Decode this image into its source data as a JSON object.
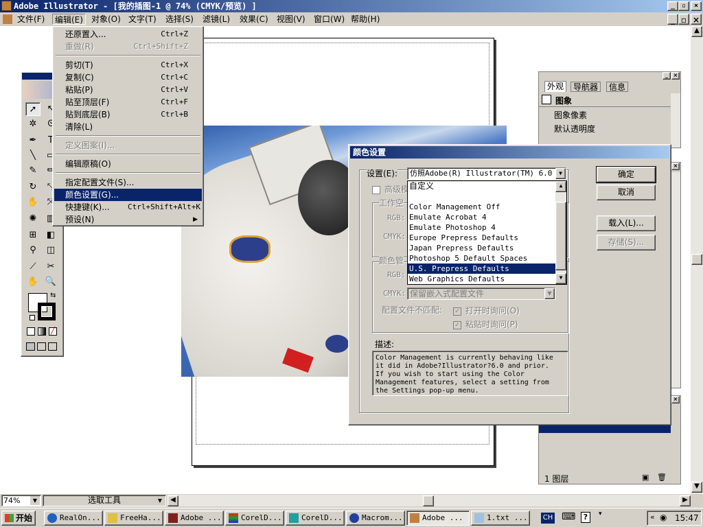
{
  "window": {
    "title": "Adobe Illustrator - [我的插图-1 @ 74% (CMYK/预览) ]"
  },
  "menubar": {
    "items": [
      "文件(F)",
      "编辑(E)",
      "对象(O)",
      "文字(T)",
      "选择(S)",
      "滤镜(L)",
      "效果(C)",
      "视图(V)",
      "窗口(W)",
      "帮助(H)"
    ]
  },
  "edit_menu": {
    "items": [
      {
        "label": "还原置入...",
        "key": "Ctrl+Z"
      },
      {
        "label": "重做(R)",
        "key": "Ctrl+Shift+Z"
      },
      {
        "label": "剪切(T)",
        "key": "Ctrl+X"
      },
      {
        "label": "复制(C)",
        "key": "Ctrl+C"
      },
      {
        "label": "粘贴(P)",
        "key": "Ctrl+V"
      },
      {
        "label": "贴至顶层(F)",
        "key": "Ctrl+F"
      },
      {
        "label": "贴到底层(B)",
        "key": "Ctrl+B"
      },
      {
        "label": "清除(L)",
        "key": ""
      },
      {
        "label": "定义图案(I)...",
        "key": ""
      },
      {
        "label": "编辑原稿(O)",
        "key": ""
      },
      {
        "label": "指定配置文件(S)...",
        "key": ""
      },
      {
        "label": "颜色设置(G)...",
        "key": ""
      },
      {
        "label": "快捷键(K)...",
        "key": "Ctrl+Shift+Alt+K"
      },
      {
        "label": "预设(N)",
        "key": ""
      }
    ]
  },
  "appearance_panel": {
    "tabs": [
      "外观",
      "导航器",
      "信息"
    ],
    "object": "图象",
    "rows": [
      "图象像素",
      "默认透明度"
    ]
  },
  "color_dialog": {
    "title": "颜色设置",
    "settings_label": "设置(E):",
    "settings_value": "仿照Adobe(R) Illustrator(TM) 6.0",
    "advanced_label": "高级模",
    "workspace_label": "工作空",
    "rgb_label": "RGB:",
    "cmyk_label": "CMYK:",
    "policy_label": "颜色管",
    "policy_cmyk_value": "保留嵌入式配置文件",
    "mismatch_label": "配置文件不匹配:",
    "ask_open": "打开时询问(O)",
    "ask_paste": "粘贴时询问(P)",
    "dropdown_options": [
      "自定义",
      "Color Management Off",
      "Emulate Acrobat 4",
      "Emulate Photoshop 4",
      "Europe Prepress Defaults",
      "Japan Prepress Defaults",
      "Photoshop 5 Default Spaces",
      "U.S. Prepress Defaults",
      "Web Graphics Defaults"
    ],
    "selected_option": "U.S. Prepress Defaults",
    "description_label": "描述:",
    "description_text": "Color Management is currently behaving like it did in Adobe?Illustrator?6.0 and prior.\nIf you wish to start using the Color Management features, select a setting from the Settings pop-up menu.",
    "ok": "确定",
    "cancel": "取消",
    "load": "载入(L)...",
    "save": "存储(S)..."
  },
  "layers_panel": {
    "count_label": "1 图层"
  },
  "status": {
    "zoom": "74%",
    "tool": "选取工具"
  },
  "taskbar": {
    "start": "开始",
    "tasks": [
      "RealOn...",
      "FreeHa...",
      "Adobe ...",
      "CorelD...",
      "CorelD...",
      "Macrom...",
      "Adobe ...",
      "1.txt ..."
    ],
    "lang": "CH",
    "time": "15:47"
  }
}
